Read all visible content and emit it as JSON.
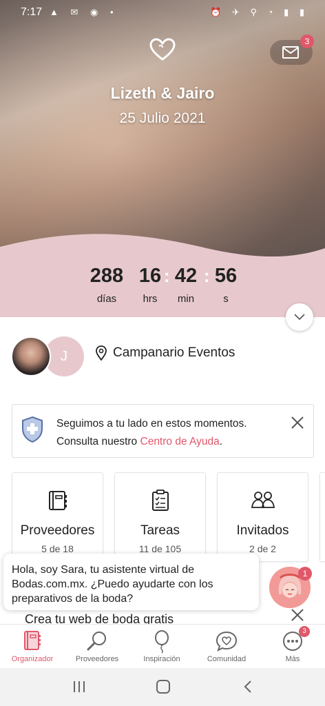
{
  "status_bar": {
    "time": "7:17",
    "left_icons": "▲ ✉ ◉ •",
    "right_icons": "⏰ ✈ ⚲ ◔ ▮ ▮"
  },
  "hero": {
    "couple_names": "Lizeth & Jairo",
    "wedding_date": "25 Julio 2021",
    "inbox_badge": "3",
    "countdown": {
      "days": {
        "value": "288",
        "unit": "días"
      },
      "hours": {
        "value": "16",
        "unit": "hrs"
      },
      "minutes": {
        "value": "42",
        "unit": "min"
      },
      "seconds": {
        "value": "56",
        "unit": "s"
      },
      "separator": ":"
    }
  },
  "profile": {
    "partner_initial": "J",
    "venue": "Campanario Eventos"
  },
  "help_banner": {
    "line1": "Seguimos a tu lado en estos momentos.",
    "line2_prefix": "Consulta nuestro ",
    "link": "Centro de Ayuda",
    "line2_suffix": "."
  },
  "cards": [
    {
      "title": "Proveedores",
      "count": "5 de 18",
      "icon": "notebook-icon"
    },
    {
      "title": "Tareas",
      "count": "11 de 105",
      "icon": "checklist-icon"
    },
    {
      "title": "Invitados",
      "count": "2 de 2",
      "icon": "guests-icon"
    }
  ],
  "assistant": {
    "line1": "Hola, soy Sara, tu asistente virtual de",
    "line2": "Bodas.com.mx. ¿Puedo ayudarte con los",
    "line3": "preparativos de la boda?",
    "badge": "1"
  },
  "web_banner": {
    "label": "Crea tu web de boda gratis"
  },
  "bottom_nav": {
    "items": [
      {
        "label": "Organizador",
        "icon": "organizer-icon",
        "active": true
      },
      {
        "label": "Proveedores",
        "icon": "search-icon",
        "active": false
      },
      {
        "label": "Inspiración",
        "icon": "balloon-icon",
        "active": false
      },
      {
        "label": "Comunidad",
        "icon": "chat-heart-icon",
        "active": false
      },
      {
        "label": "Más",
        "icon": "more-icon",
        "active": false,
        "badge": "3"
      }
    ]
  },
  "colors": {
    "accent": "#e0586a",
    "blush": "#e7c9cd",
    "text": "#222222"
  }
}
